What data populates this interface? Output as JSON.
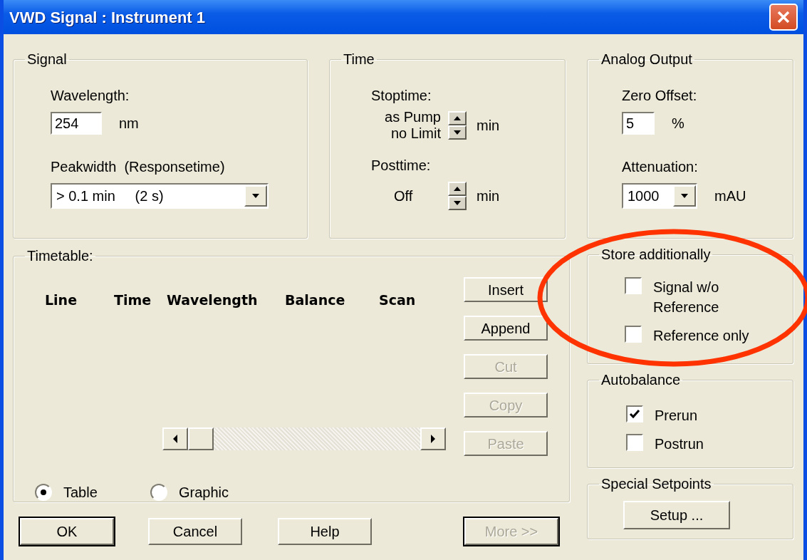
{
  "window": {
    "title": "VWD Signal : Instrument 1"
  },
  "signal": {
    "title": "Signal",
    "wavelength_label": "Wavelength:",
    "wavelength_value": "254",
    "wavelength_unit": "nm",
    "peakwidth_label": "Peakwidth  (Responsetime)",
    "peakwidth_value": "> 0.1 min     (2 s)"
  },
  "time": {
    "title": "Time",
    "stoptime_label": "Stoptime:",
    "stoptime_value": "as Pump\nno Limit",
    "stoptime_unit": "min",
    "posttime_label": "Posttime:",
    "posttime_value": "Off",
    "posttime_unit": "min"
  },
  "analog_output": {
    "title": "Analog Output",
    "zero_offset_label": "Zero Offset:",
    "zero_offset_value": "5",
    "zero_offset_unit": "%",
    "attenuation_label": "Attenuation:",
    "attenuation_value": "1000",
    "attenuation_unit": "mAU"
  },
  "timetable": {
    "title": "Timetable:",
    "columns": [
      "Line",
      "Time",
      "Wavelength",
      "Balance",
      "Scan"
    ],
    "buttons": [
      {
        "label": "Insert",
        "disabled": false
      },
      {
        "label": "Append",
        "disabled": false
      },
      {
        "label": "Cut",
        "disabled": true
      },
      {
        "label": "Copy",
        "disabled": true
      },
      {
        "label": "Paste",
        "disabled": true
      }
    ],
    "view_options": [
      {
        "label": "Table",
        "selected": true
      },
      {
        "label": "Graphic",
        "selected": false
      }
    ]
  },
  "store_additionally": {
    "title": "Store additionally",
    "options": [
      {
        "label": "Signal w/o Reference",
        "checked": false
      },
      {
        "label": "Reference only",
        "checked": false
      }
    ]
  },
  "autobalance": {
    "title": "Autobalance",
    "options": [
      {
        "label": "Prerun",
        "checked": true
      },
      {
        "label": "Postrun",
        "checked": false
      }
    ]
  },
  "special_setpoints": {
    "title": "Special Setpoints",
    "button": "Setup ..."
  },
  "buttons": [
    {
      "label": "OK",
      "default": true,
      "disabled": false
    },
    {
      "label": "Cancel",
      "default": false,
      "disabled": false
    },
    {
      "label": "Help",
      "default": false,
      "disabled": false
    },
    {
      "label": "More >>",
      "default": true,
      "disabled": true
    }
  ]
}
